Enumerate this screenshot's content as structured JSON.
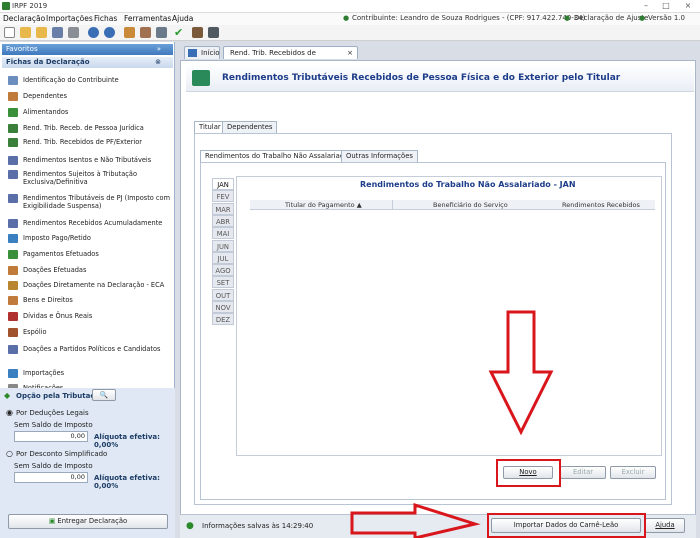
{
  "window": {
    "title": "IRPF 2019",
    "controls": [
      "–",
      "□",
      "×"
    ]
  },
  "menu": {
    "items": [
      "Declaração",
      "Importações",
      "Fichas",
      "Ferramentas",
      "Ajuda"
    ],
    "contribuinte": "Contribuinte: Leandro de Souza Rodrigues - (CPF: 917.422.740-34)",
    "tipo": "Declaração de Ajuste",
    "versao": "Versão 1.0"
  },
  "sidebar": {
    "favoritos": "Favoritos",
    "fichas_title": "Fichas da Declaração",
    "items": [
      {
        "label": "Identificação do Contribuinte",
        "color": "#6c8ebf"
      },
      {
        "label": "Dependentes",
        "color": "#c07a3a"
      },
      {
        "label": "Alimentandos",
        "color": "#3a8f3a"
      },
      {
        "label": "Rend. Trib. Receb. de Pessoa Jurídica",
        "color": "#3a7f3a"
      },
      {
        "label": "Rend. Trib. Recebidos de PF/Exterior",
        "color": "#3a7f3a"
      },
      {
        "label": "Rendimentos Isentos e Não Tributáveis",
        "color": "#5a6ea8"
      },
      {
        "label": "Rendimentos Sujeitos à Tributação Exclusiva/Definitiva",
        "color": "#5a6ea8"
      },
      {
        "label": "Rendimentos Tributáveis de PJ (Imposto com Exigibilidade Suspensa)",
        "color": "#5a6ea8"
      },
      {
        "label": "Rendimentos Recebidos Acumuladamente",
        "color": "#5a6ea8"
      },
      {
        "label": "Imposto Pago/Retido",
        "color": "#3a7fbf"
      },
      {
        "label": "Pagamentos Efetuados",
        "color": "#3a8f3a"
      },
      {
        "label": "Doações Efetuadas",
        "color": "#c07a3a"
      },
      {
        "label": "Doações Diretamente na Declaração - ECA",
        "color": "#b8862e"
      },
      {
        "label": "Bens e Direitos",
        "color": "#c07a3a"
      },
      {
        "label": "Dívidas e Ônus Reais",
        "color": "#b03030"
      },
      {
        "label": "Espólio",
        "color": "#a0522d"
      },
      {
        "label": "Doações a Partidos Políticos e Candidatos",
        "color": "#5a6ea8"
      },
      {
        "label": "Importações",
        "color": "#3a7fbf"
      },
      {
        "label": "Notificações",
        "color": "#888888"
      }
    ],
    "opcao_title": "Opção pela Tributação:",
    "deducoes": "Por Deduções Legais",
    "saldo1": "Sem Saldo de Imposto",
    "valor1": "0,00",
    "aliquota1": "Alíquota efetiva: 0,00%",
    "simplificado": "Por Desconto Simplificado",
    "saldo2": "Sem Saldo de Imposto",
    "valor2": "0,00",
    "aliquota2": "Alíquota efetiva: 0,00%",
    "entregar": "Entregar Declaração"
  },
  "tabs": {
    "inicio": "Início",
    "atual": "Rend. Trib. Recebidos de PF/Exterior"
  },
  "page": {
    "title": "Rendimentos Tributáveis Recebidos de Pessoa Física e do Exterior pelo Titular",
    "subtab_titular": "Titular",
    "subtab_dependentes": "Dependentes",
    "inner_tab1": "Rendimentos do Trabalho Não Assalariado",
    "inner_tab2": "Outras Informações",
    "months": [
      "JAN",
      "FEV",
      "MAR",
      "ABR",
      "MAI",
      "JUN",
      "JUL",
      "AGO",
      "SET",
      "OUT",
      "NOV",
      "DEZ"
    ],
    "grid_title": "Rendimentos do Trabalho Não Assalariado - JAN",
    "columns": [
      "Titular do Pagamento",
      "Beneficiário do Serviço",
      "Rendimentos Recebidos"
    ],
    "sort_arrow": "▲",
    "novo": "Novo",
    "editar": "Editar",
    "excluir": "Excluir"
  },
  "status": {
    "info": "Informações salvas às 14:29:40",
    "importar": "Importar Dados do Carnê-Leão",
    "ajuda": "Ajuda"
  }
}
